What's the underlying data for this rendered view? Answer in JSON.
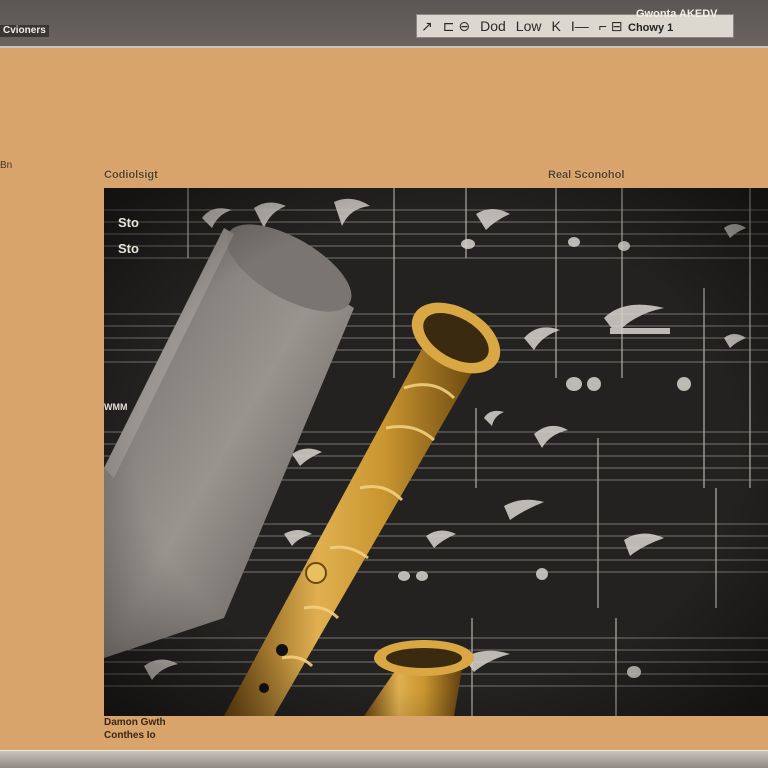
{
  "titlebar": {
    "app_label": "Cvioners",
    "toolbar_items": [
      "↗",
      "⊏ ⊖",
      "Dod",
      "Low",
      "K",
      "I—",
      "⌐ ⊟"
    ],
    "right_line1": "Gwonta AKEDV",
    "right_line2": "Chowy 1"
  },
  "left_mark": "Bn",
  "panel": {
    "left_label": "Codiolsigt",
    "right_label": "Real Sconohol"
  },
  "viewer": {
    "corner_lines": [
      "Sto",
      "Sto"
    ],
    "side_note": "WMM",
    "subject": "clarinet-on-sheet-music",
    "colors": {
      "background": "#1f1f1d",
      "staff": "#9a9690",
      "brass": "#c9952f",
      "paper_roll": "#8a8480"
    }
  },
  "bottom": {
    "line1": "Damon Gwth",
    "line2": "Conthes Io"
  }
}
